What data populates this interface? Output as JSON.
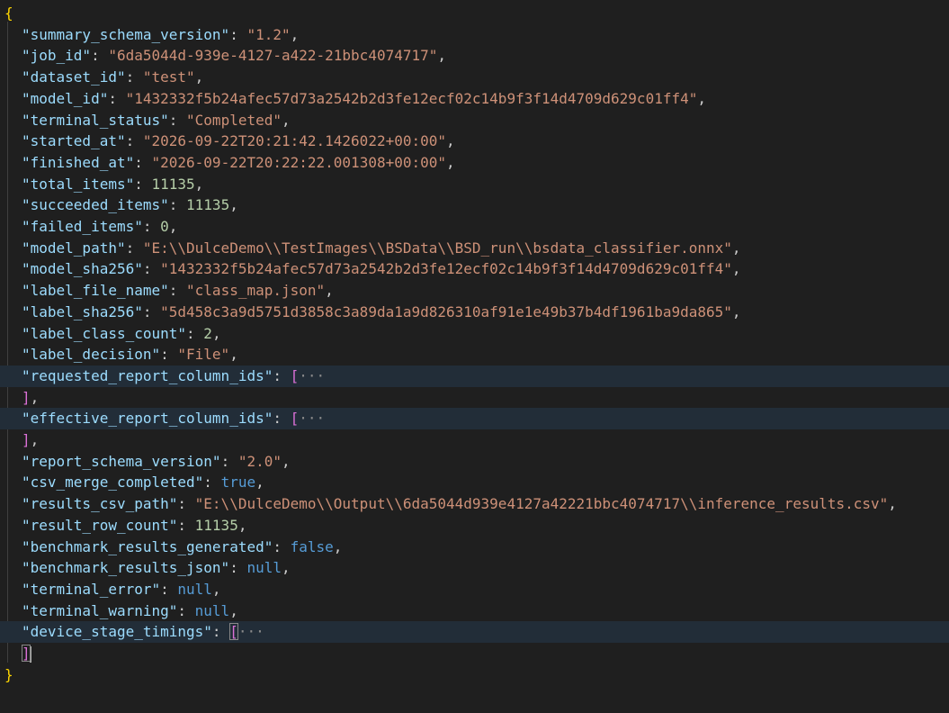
{
  "editor": {
    "open_brace": "{",
    "close_brace": "}",
    "open_bracket": "[",
    "close_bracket": "]",
    "close_bracket_comma": "],",
    "fold_ellipsis": "···",
    "colors": {
      "background": "#1f1f1f",
      "key": "#9cdcfe",
      "string": "#ce9178",
      "number": "#b5cea8",
      "keyword": "#569cd6",
      "brace": "#ffd700",
      "bracket": "#da70d6",
      "folded_line_bg": "#222d38"
    }
  },
  "lines": [
    {
      "key": "\"summary_schema_version\"",
      "value": "\"1.2\"",
      "type": "str"
    },
    {
      "key": "\"job_id\"",
      "value": "\"6da5044d-939e-4127-a422-21bbc4074717\"",
      "type": "str"
    },
    {
      "key": "\"dataset_id\"",
      "value": "\"test\"",
      "type": "str"
    },
    {
      "key": "\"model_id\"",
      "value": "\"1432332f5b24afec57d73a2542b2d3fe12ecf02c14b9f3f14d4709d629c01ff4\"",
      "type": "str"
    },
    {
      "key": "\"terminal_status\"",
      "value": "\"Completed\"",
      "type": "str"
    },
    {
      "key": "\"started_at\"",
      "value": "\"2026-09-22T20:21:42.1426022+00:00\"",
      "type": "str"
    },
    {
      "key": "\"finished_at\"",
      "value": "\"2026-09-22T20:22:22.001308+00:00\"",
      "type": "str"
    },
    {
      "key": "\"total_items\"",
      "value": "11135",
      "type": "num"
    },
    {
      "key": "\"succeeded_items\"",
      "value": "11135",
      "type": "num"
    },
    {
      "key": "\"failed_items\"",
      "value": "0",
      "type": "num"
    },
    {
      "key": "\"model_path\"",
      "value": "\"E:\\\\DulceDemo\\\\TestImages\\\\BSData\\\\BSD_run\\\\bsdata_classifier.onnx\"",
      "type": "str"
    },
    {
      "key": "\"model_sha256\"",
      "value": "\"1432332f5b24afec57d73a2542b2d3fe12ecf02c14b9f3f14d4709d629c01ff4\"",
      "type": "str"
    },
    {
      "key": "\"label_file_name\"",
      "value": "\"class_map.json\"",
      "type": "str"
    },
    {
      "key": "\"label_sha256\"",
      "value": "\"5d458c3a9d5751d3858c3a89da1a9d826310af91e1e49b37b4df1961ba9da865\"",
      "type": "str"
    },
    {
      "key": "\"label_class_count\"",
      "value": "2",
      "type": "num"
    },
    {
      "key": "\"label_decision\"",
      "value": "\"File\"",
      "type": "str"
    },
    {
      "key": "\"requested_report_column_ids\"",
      "type": "fold"
    },
    {
      "key": "\"effective_report_column_ids\"",
      "type": "fold"
    },
    {
      "key": "\"report_schema_version\"",
      "value": "\"2.0\"",
      "type": "str"
    },
    {
      "key": "\"csv_merge_completed\"",
      "value": "true",
      "type": "kw"
    },
    {
      "key": "\"results_csv_path\"",
      "value": "\"E:\\\\DulceDemo\\\\Output\\\\6da5044d939e4127a42221bbc4074717\\\\inference_results.csv\"",
      "type": "str"
    },
    {
      "key": "\"result_row_count\"",
      "value": "11135",
      "type": "num"
    },
    {
      "key": "\"benchmark_results_generated\"",
      "value": "false",
      "type": "kw"
    },
    {
      "key": "\"benchmark_results_json\"",
      "value": "null",
      "type": "kw"
    },
    {
      "key": "\"terminal_error\"",
      "value": "null",
      "type": "kw"
    },
    {
      "key": "\"terminal_warning\"",
      "value": "null",
      "type": "kw"
    },
    {
      "key": "\"device_stage_timings\"",
      "type": "fold-last"
    }
  ]
}
